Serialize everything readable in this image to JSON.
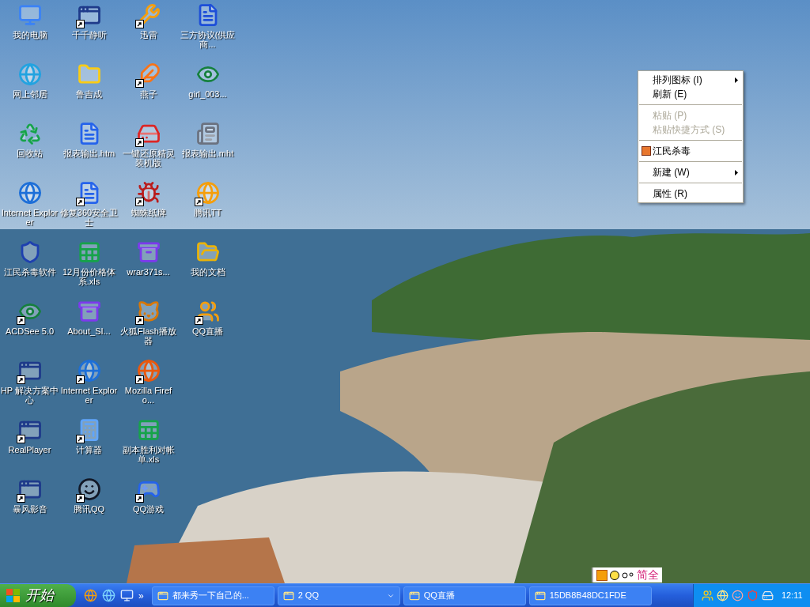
{
  "desktop_icons": [
    {
      "label": "我的电脑",
      "shortcut": false
    },
    {
      "label": "网上邻居",
      "shortcut": false
    },
    {
      "label": "回收站",
      "shortcut": false
    },
    {
      "label": "Internet Explorer",
      "shortcut": false
    },
    {
      "label": "江民杀毒软件",
      "shortcut": false
    },
    {
      "label": "ACDSee 5.0",
      "shortcut": true
    },
    {
      "label": "HP 解决方案中心",
      "shortcut": true
    },
    {
      "label": "RealPlayer",
      "shortcut": true
    },
    {
      "label": "暴风影音",
      "shortcut": true
    },
    {
      "label": "千千静听",
      "shortcut": true
    },
    {
      "label": "鲁吉成",
      "shortcut": false
    },
    {
      "label": "报表输出.htm",
      "shortcut": false
    },
    {
      "label": "修复360安全卫士",
      "shortcut": true
    },
    {
      "label": "12月份价格体系.xls",
      "shortcut": false
    },
    {
      "label": "About_SI...",
      "shortcut": false
    },
    {
      "label": "Internet Explorer",
      "shortcut": true
    },
    {
      "label": "计算器",
      "shortcut": true
    },
    {
      "label": "腾讯QQ",
      "shortcut": true
    },
    {
      "label": "迅雷",
      "shortcut": true
    },
    {
      "label": "燕子",
      "shortcut": true
    },
    {
      "label": "一键还原精灵装机版",
      "shortcut": true
    },
    {
      "label": "蜘蛛纸牌",
      "shortcut": true
    },
    {
      "label": "wrar371s...",
      "shortcut": false
    },
    {
      "label": "火狐Flash播放器",
      "shortcut": true
    },
    {
      "label": "Mozilla Firefo...",
      "shortcut": true
    },
    {
      "label": "副本胜利对帐单.xls",
      "shortcut": false
    },
    {
      "label": "QQ游戏",
      "shortcut": true
    },
    {
      "label": "三方协议(供应商...",
      "shortcut": false
    },
    {
      "label": "girl_003...",
      "shortcut": false
    },
    {
      "label": "报表输出.mht",
      "shortcut": false
    },
    {
      "label": "腾讯TT",
      "shortcut": true
    },
    {
      "label": "我的文档",
      "shortcut": false
    },
    {
      "label": "QQ直播",
      "shortcut": true
    }
  ],
  "context_menu": [
    {
      "kind": "item",
      "label": "排列图标 (I)",
      "submenu": true,
      "disabled": false,
      "icon": false
    },
    {
      "kind": "item",
      "label": "刷新 (E)",
      "submenu": false,
      "disabled": false,
      "icon": false
    },
    {
      "kind": "separator"
    },
    {
      "kind": "item",
      "label": "粘贴 (P)",
      "submenu": false,
      "disabled": true,
      "icon": false
    },
    {
      "kind": "item",
      "label": "粘贴快捷方式 (S)",
      "submenu": false,
      "disabled": true,
      "icon": false
    },
    {
      "kind": "separator"
    },
    {
      "kind": "item",
      "label": "江民杀毒",
      "submenu": false,
      "disabled": false,
      "icon": true
    },
    {
      "kind": "separator"
    },
    {
      "kind": "item",
      "label": "新建 (W)",
      "submenu": true,
      "disabled": false,
      "icon": false
    },
    {
      "kind": "separator"
    },
    {
      "kind": "item",
      "label": "属性 (R)",
      "submenu": false,
      "disabled": false,
      "icon": false
    }
  ],
  "ime_bar": {
    "mode": "简全"
  },
  "taskbar": {
    "start": "开始",
    "more": "»",
    "tasks": [
      {
        "label": "都来秀一下自己的...",
        "dropdown": false
      },
      {
        "label": "2 QQ",
        "dropdown": true
      },
      {
        "label": "QQ直播",
        "dropdown": false
      },
      {
        "label": "15DB8B48DC1FDE",
        "dropdown": false
      }
    ],
    "clock": "12:11"
  }
}
